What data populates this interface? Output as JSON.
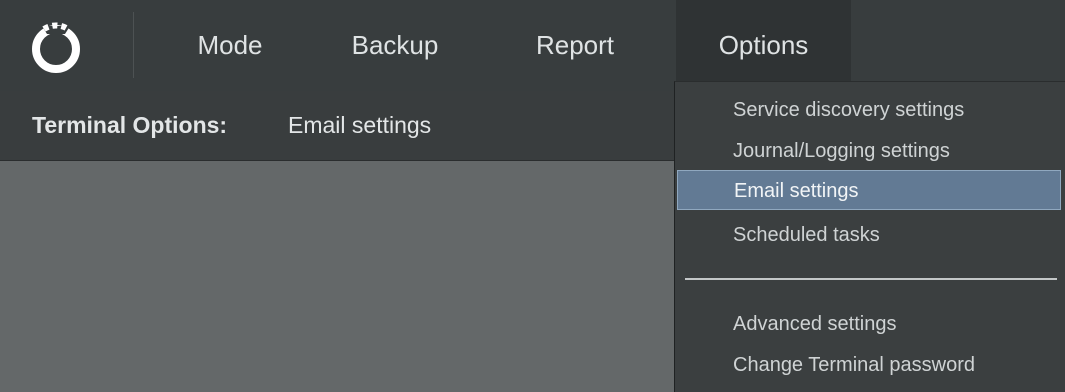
{
  "menubar": {
    "items": [
      "Mode",
      "Backup",
      "Report",
      "Options"
    ],
    "active": "Options"
  },
  "subheader": {
    "label": "Terminal Options:",
    "value": "Email settings"
  },
  "options_menu": {
    "group1": [
      "Service discovery settings",
      "Journal/Logging settings",
      "Email settings",
      "Scheduled tasks"
    ],
    "group2": [
      "Advanced settings",
      "Change Terminal password"
    ],
    "selected": "Email settings"
  },
  "colors": {
    "topbar": "#383d3e",
    "content": "#646869",
    "selection": "#627a94"
  },
  "icons": {
    "logo": "ring-logo-icon"
  }
}
